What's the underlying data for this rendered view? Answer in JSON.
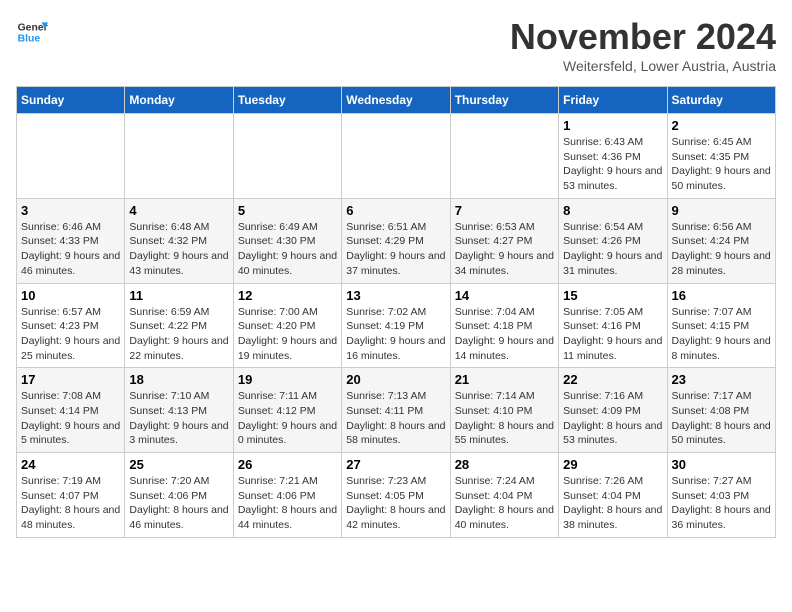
{
  "header": {
    "logo": {
      "line1": "General",
      "line2": "Blue"
    },
    "title": "November 2024",
    "location": "Weitersfeld, Lower Austria, Austria"
  },
  "days_of_week": [
    "Sunday",
    "Monday",
    "Tuesday",
    "Wednesday",
    "Thursday",
    "Friday",
    "Saturday"
  ],
  "weeks": [
    [
      {
        "day": "",
        "info": ""
      },
      {
        "day": "",
        "info": ""
      },
      {
        "day": "",
        "info": ""
      },
      {
        "day": "",
        "info": ""
      },
      {
        "day": "",
        "info": ""
      },
      {
        "day": "1",
        "info": "Sunrise: 6:43 AM\nSunset: 4:36 PM\nDaylight: 9 hours and 53 minutes."
      },
      {
        "day": "2",
        "info": "Sunrise: 6:45 AM\nSunset: 4:35 PM\nDaylight: 9 hours and 50 minutes."
      }
    ],
    [
      {
        "day": "3",
        "info": "Sunrise: 6:46 AM\nSunset: 4:33 PM\nDaylight: 9 hours and 46 minutes."
      },
      {
        "day": "4",
        "info": "Sunrise: 6:48 AM\nSunset: 4:32 PM\nDaylight: 9 hours and 43 minutes."
      },
      {
        "day": "5",
        "info": "Sunrise: 6:49 AM\nSunset: 4:30 PM\nDaylight: 9 hours and 40 minutes."
      },
      {
        "day": "6",
        "info": "Sunrise: 6:51 AM\nSunset: 4:29 PM\nDaylight: 9 hours and 37 minutes."
      },
      {
        "day": "7",
        "info": "Sunrise: 6:53 AM\nSunset: 4:27 PM\nDaylight: 9 hours and 34 minutes."
      },
      {
        "day": "8",
        "info": "Sunrise: 6:54 AM\nSunset: 4:26 PM\nDaylight: 9 hours and 31 minutes."
      },
      {
        "day": "9",
        "info": "Sunrise: 6:56 AM\nSunset: 4:24 PM\nDaylight: 9 hours and 28 minutes."
      }
    ],
    [
      {
        "day": "10",
        "info": "Sunrise: 6:57 AM\nSunset: 4:23 PM\nDaylight: 9 hours and 25 minutes."
      },
      {
        "day": "11",
        "info": "Sunrise: 6:59 AM\nSunset: 4:22 PM\nDaylight: 9 hours and 22 minutes."
      },
      {
        "day": "12",
        "info": "Sunrise: 7:00 AM\nSunset: 4:20 PM\nDaylight: 9 hours and 19 minutes."
      },
      {
        "day": "13",
        "info": "Sunrise: 7:02 AM\nSunset: 4:19 PM\nDaylight: 9 hours and 16 minutes."
      },
      {
        "day": "14",
        "info": "Sunrise: 7:04 AM\nSunset: 4:18 PM\nDaylight: 9 hours and 14 minutes."
      },
      {
        "day": "15",
        "info": "Sunrise: 7:05 AM\nSunset: 4:16 PM\nDaylight: 9 hours and 11 minutes."
      },
      {
        "day": "16",
        "info": "Sunrise: 7:07 AM\nSunset: 4:15 PM\nDaylight: 9 hours and 8 minutes."
      }
    ],
    [
      {
        "day": "17",
        "info": "Sunrise: 7:08 AM\nSunset: 4:14 PM\nDaylight: 9 hours and 5 minutes."
      },
      {
        "day": "18",
        "info": "Sunrise: 7:10 AM\nSunset: 4:13 PM\nDaylight: 9 hours and 3 minutes."
      },
      {
        "day": "19",
        "info": "Sunrise: 7:11 AM\nSunset: 4:12 PM\nDaylight: 9 hours and 0 minutes."
      },
      {
        "day": "20",
        "info": "Sunrise: 7:13 AM\nSunset: 4:11 PM\nDaylight: 8 hours and 58 minutes."
      },
      {
        "day": "21",
        "info": "Sunrise: 7:14 AM\nSunset: 4:10 PM\nDaylight: 8 hours and 55 minutes."
      },
      {
        "day": "22",
        "info": "Sunrise: 7:16 AM\nSunset: 4:09 PM\nDaylight: 8 hours and 53 minutes."
      },
      {
        "day": "23",
        "info": "Sunrise: 7:17 AM\nSunset: 4:08 PM\nDaylight: 8 hours and 50 minutes."
      }
    ],
    [
      {
        "day": "24",
        "info": "Sunrise: 7:19 AM\nSunset: 4:07 PM\nDaylight: 8 hours and 48 minutes."
      },
      {
        "day": "25",
        "info": "Sunrise: 7:20 AM\nSunset: 4:06 PM\nDaylight: 8 hours and 46 minutes."
      },
      {
        "day": "26",
        "info": "Sunrise: 7:21 AM\nSunset: 4:06 PM\nDaylight: 8 hours and 44 minutes."
      },
      {
        "day": "27",
        "info": "Sunrise: 7:23 AM\nSunset: 4:05 PM\nDaylight: 8 hours and 42 minutes."
      },
      {
        "day": "28",
        "info": "Sunrise: 7:24 AM\nSunset: 4:04 PM\nDaylight: 8 hours and 40 minutes."
      },
      {
        "day": "29",
        "info": "Sunrise: 7:26 AM\nSunset: 4:04 PM\nDaylight: 8 hours and 38 minutes."
      },
      {
        "day": "30",
        "info": "Sunrise: 7:27 AM\nSunset: 4:03 PM\nDaylight: 8 hours and 36 minutes."
      }
    ]
  ]
}
